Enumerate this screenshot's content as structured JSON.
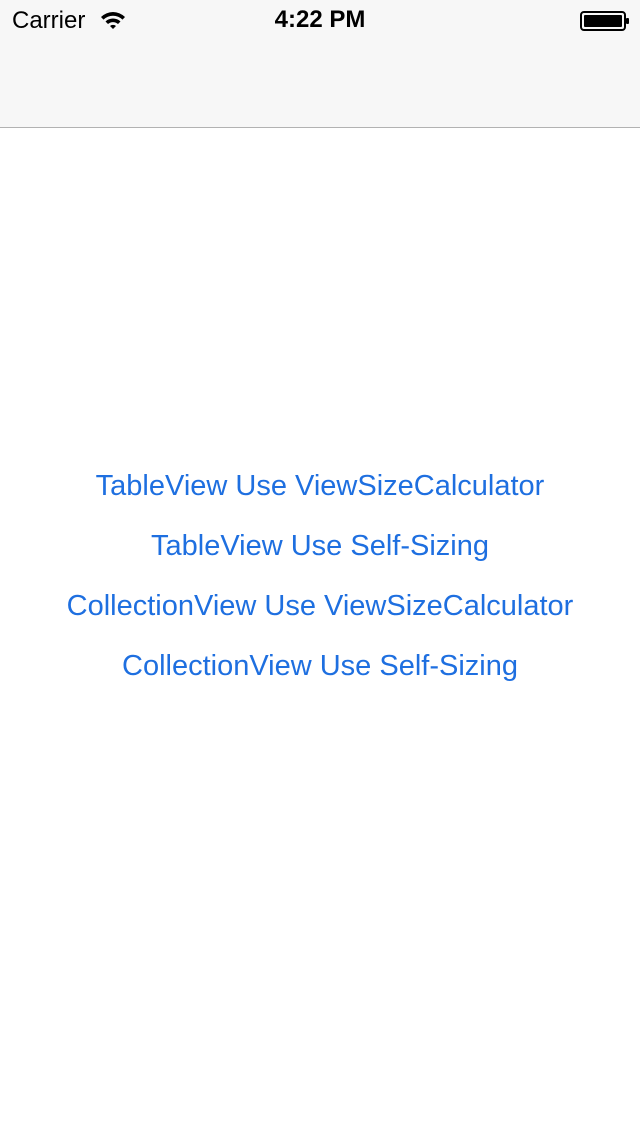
{
  "status_bar": {
    "carrier": "Carrier",
    "time": "4:22 PM",
    "wifi_icon": "wifi-icon",
    "battery_icon": "battery-full-icon"
  },
  "menu": {
    "items": [
      {
        "label": "TableView Use ViewSizeCalculator"
      },
      {
        "label": "TableView Use Self-Sizing"
      },
      {
        "label": "CollectionView Use ViewSizeCalculator"
      },
      {
        "label": "CollectionView Use Self-Sizing"
      }
    ],
    "link_color": "#1E6FE0"
  },
  "colors": {
    "nav_background": "#F7F7F7",
    "nav_border": "#B2B2B2",
    "background": "#FFFFFF"
  }
}
